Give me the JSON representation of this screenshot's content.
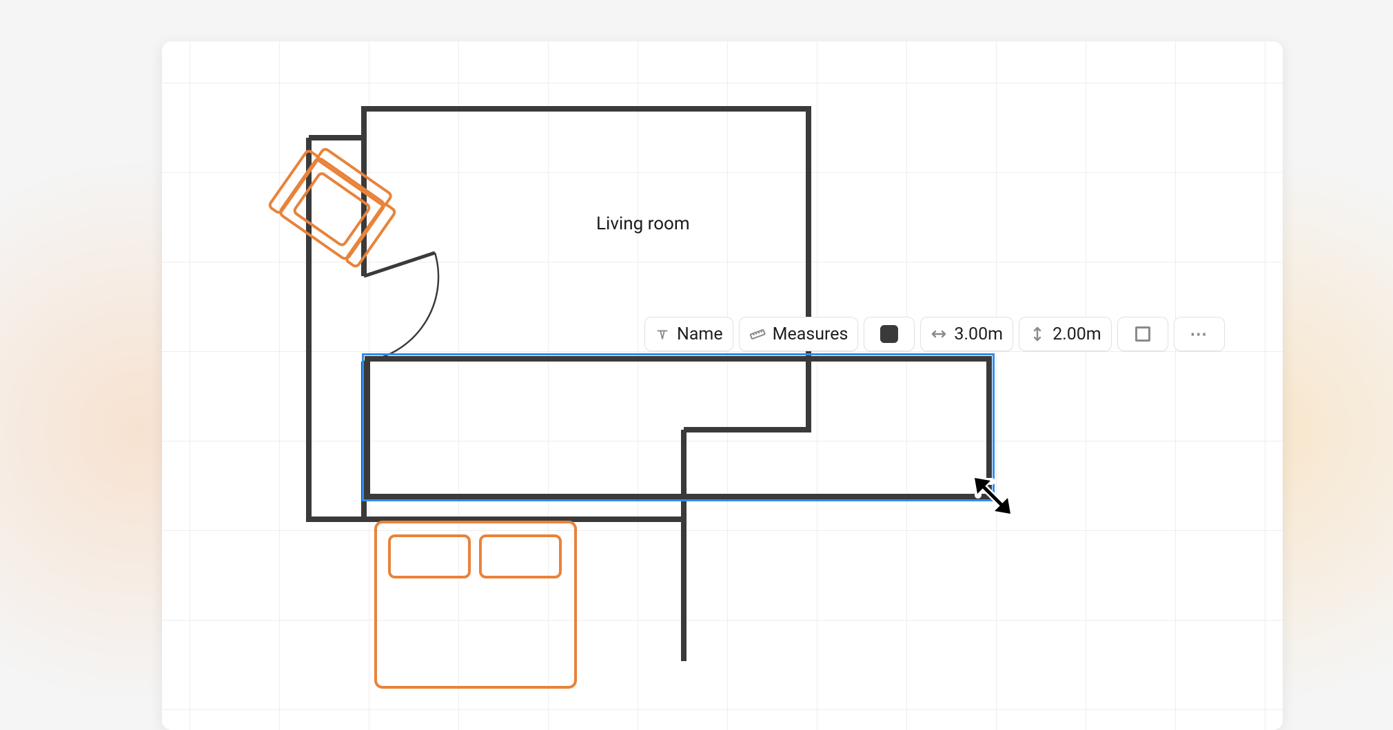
{
  "canvas": {
    "room_label": "Living room"
  },
  "toolbar": {
    "name_label": "Name",
    "measures_label": "Measures",
    "width_value": "3.00m",
    "height_value": "2.00m",
    "more_label": "⋯"
  },
  "colors": {
    "wall": "#3a3a3a",
    "furniture": "#e8833a",
    "selection": "#2f8eed"
  }
}
